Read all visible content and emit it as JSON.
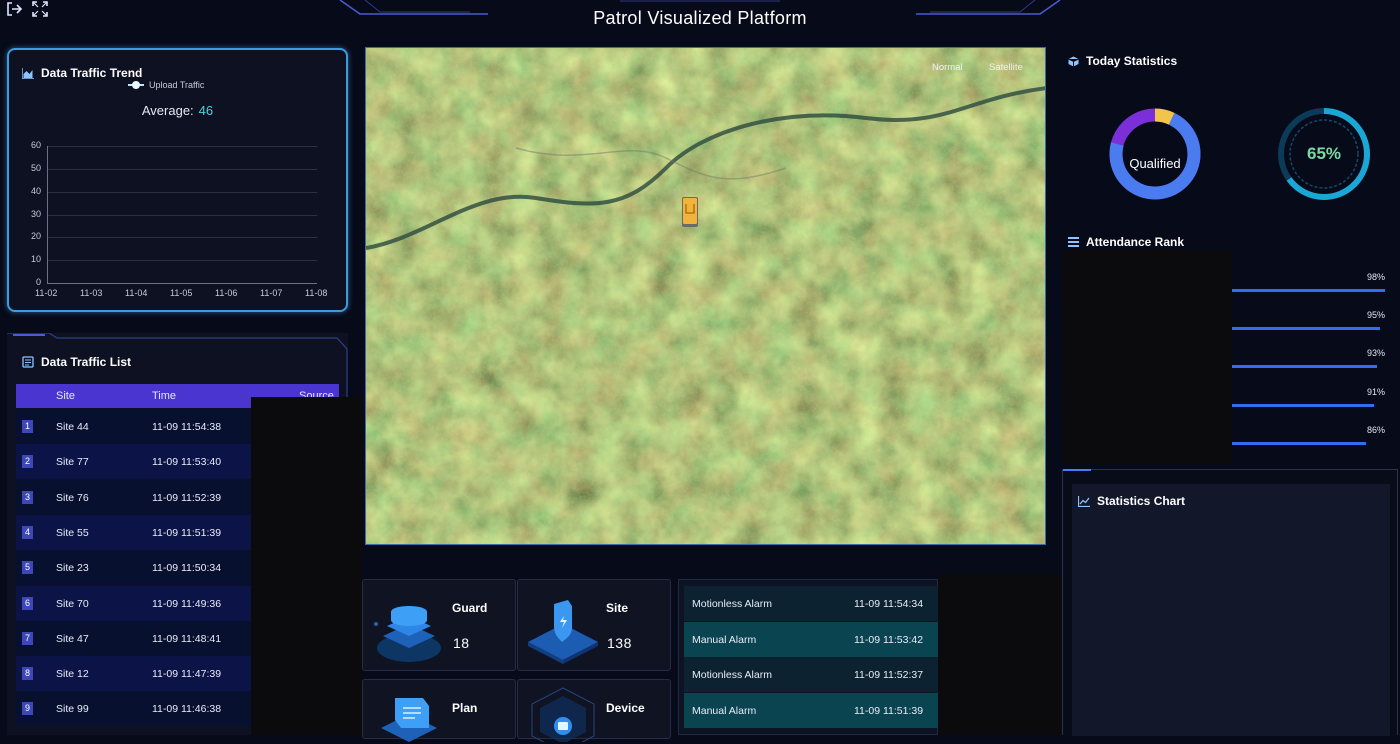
{
  "header": {
    "title": "Patrol Visualized Platform",
    "icons": [
      "logout-icon",
      "fullscreen-icon"
    ]
  },
  "traffic_trend": {
    "title": "Data Traffic Trend",
    "average_label": "Average:",
    "average_value": "46",
    "chart_data": {
      "type": "line",
      "categories": [
        "11-02",
        "11-03",
        "11-04",
        "11-05",
        "11-06",
        "11-07",
        "11-08"
      ],
      "series": [
        {
          "name": "Upload Traffic",
          "values": []
        }
      ],
      "yticks": [
        "60",
        "50",
        "40",
        "30",
        "20",
        "10",
        "0"
      ],
      "ylim": [
        0,
        60
      ],
      "grid": true,
      "legend": "top-center"
    }
  },
  "traffic_list": {
    "title": "Data Traffic List",
    "columns": [
      "Site",
      "Time",
      "Source"
    ],
    "rows": [
      {
        "idx": "1",
        "site": "Site 44",
        "time": "11-09 11:54:38"
      },
      {
        "idx": "2",
        "site": "Site 77",
        "time": "11-09 11:53:40"
      },
      {
        "idx": "3",
        "site": "Site 76",
        "time": "11-09 11:52:39"
      },
      {
        "idx": "4",
        "site": "Site 55",
        "time": "11-09 11:51:39"
      },
      {
        "idx": "5",
        "site": "Site 23",
        "time": "11-09 11:50:34"
      },
      {
        "idx": "6",
        "site": "Site 70",
        "time": "11-09 11:49:36"
      },
      {
        "idx": "7",
        "site": "Site 47",
        "time": "11-09 11:48:41"
      },
      {
        "idx": "8",
        "site": "Site 12",
        "time": "11-09 11:47:39"
      },
      {
        "idx": "9",
        "site": "Site 99",
        "time": "11-09 11:46:38"
      }
    ]
  },
  "map": {
    "buttons": [
      "Normal",
      "Satellite"
    ],
    "selected": "Satellite"
  },
  "cards": [
    {
      "label": "Guard",
      "value": "18",
      "icon": "guard-stack-icon"
    },
    {
      "label": "Site",
      "value": "138",
      "icon": "site-shield-icon"
    },
    {
      "label": "Plan",
      "value": "",
      "icon": "plan-document-icon"
    },
    {
      "label": "Device",
      "value": "",
      "icon": "device-cube-icon"
    }
  ],
  "alarms": [
    {
      "name": "Motionless Alarm",
      "time": "11-09 11:54:34"
    },
    {
      "name": "Manual Alarm",
      "time": "11-09 11:53:42"
    },
    {
      "name": "Motionless Alarm",
      "time": "11-09 11:52:37"
    },
    {
      "name": "Manual Alarm",
      "time": "11-09 11:51:39"
    }
  ],
  "today_stats": {
    "title": "Today Statistics",
    "donut_label": "Qualified",
    "donut_fraction": 0.93,
    "percent_label": "65%",
    "percent_fraction": 0.65,
    "colors": {
      "donut_main": "#4a7cf0",
      "donut_accent": "#f0c54a",
      "donut_purple": "#7a2fd8",
      "gauge": "#1aa7d6",
      "gauge_text": "#7cd9a3"
    }
  },
  "attendance": {
    "title": "Attendance Rank",
    "items": [
      {
        "pct": "98%",
        "value": 98
      },
      {
        "pct": "95%",
        "value": 95
      },
      {
        "pct": "93%",
        "value": 93
      },
      {
        "pct": "91%",
        "value": 91
      },
      {
        "pct": "86%",
        "value": 86
      }
    ]
  },
  "stat_chart": {
    "title": "Statistics Chart"
  }
}
